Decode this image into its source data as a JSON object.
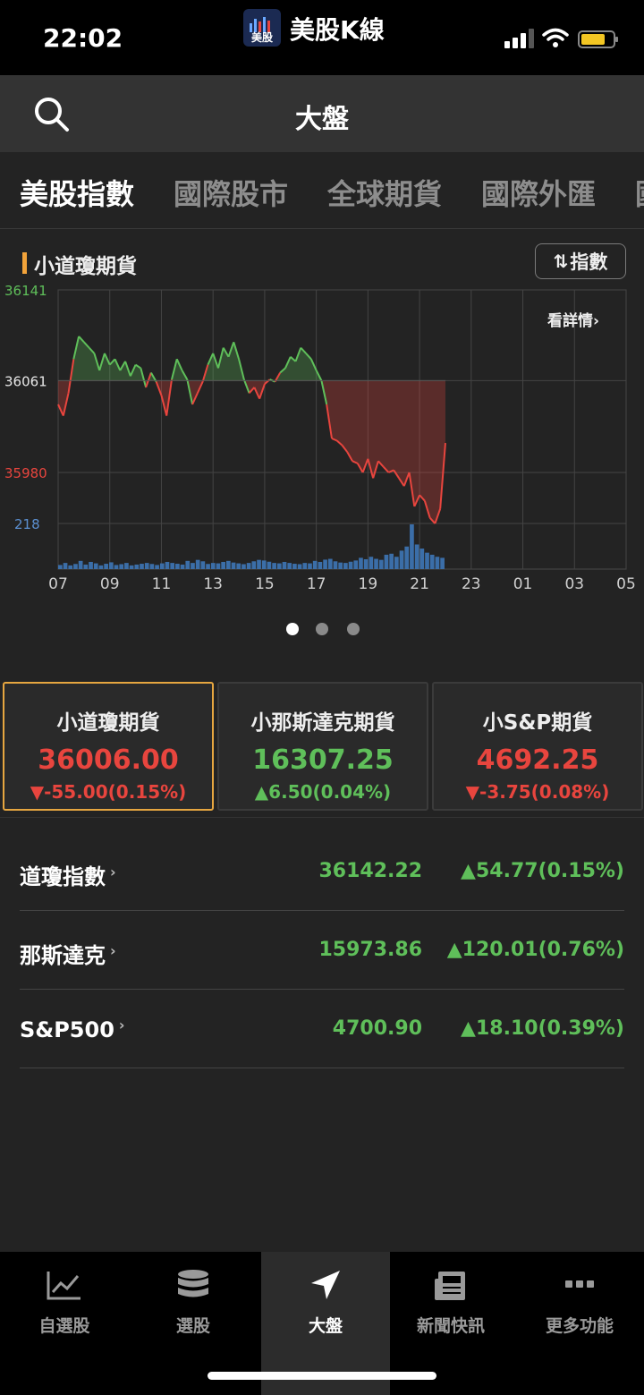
{
  "status": {
    "time": "22:02",
    "app_name": "美股K線",
    "app_badge": "美股"
  },
  "nav": {
    "title": "大盤"
  },
  "tabs": [
    {
      "label": "美股指數",
      "active": true
    },
    {
      "label": "國際股市",
      "active": false
    },
    {
      "label": "全球期貨",
      "active": false
    },
    {
      "label": "國際外匯",
      "active": false
    },
    {
      "label": "國",
      "active": false
    }
  ],
  "chart_card": {
    "title": "小道瓊期貨",
    "toggle_label": "指數",
    "detail_label": "看詳情",
    "pages": 3,
    "active_page": 0
  },
  "chart_data": {
    "type": "line",
    "title": "小道瓊期貨",
    "y_ticks": [
      {
        "label": "36141",
        "value": 36141,
        "color": "#5fbf5a"
      },
      {
        "label": "36061",
        "value": 36061,
        "color": "#e8e8e8"
      },
      {
        "label": "35980",
        "value": 35980,
        "color": "#e8453e"
      }
    ],
    "ylim": [
      35980,
      36141
    ],
    "reference": 36061,
    "x_ticks": [
      "07",
      "09",
      "11",
      "13",
      "15",
      "17",
      "19",
      "21",
      "23",
      "01",
      "03",
      "05"
    ],
    "x_range_hours": [
      7,
      29
    ],
    "volume_label": "218",
    "volume_max": 218,
    "price_points": [
      [
        7.0,
        36040
      ],
      [
        7.2,
        36030
      ],
      [
        7.4,
        36050
      ],
      [
        7.6,
        36080
      ],
      [
        7.8,
        36100
      ],
      [
        8.0,
        36095
      ],
      [
        8.2,
        36090
      ],
      [
        8.4,
        36085
      ],
      [
        8.6,
        36070
      ],
      [
        8.8,
        36085
      ],
      [
        9.0,
        36075
      ],
      [
        9.2,
        36080
      ],
      [
        9.4,
        36070
      ],
      [
        9.6,
        36078
      ],
      [
        9.8,
        36065
      ],
      [
        10.0,
        36075
      ],
      [
        10.2,
        36072
      ],
      [
        10.4,
        36055
      ],
      [
        10.6,
        36068
      ],
      [
        10.8,
        36060
      ],
      [
        11.0,
        36048
      ],
      [
        11.2,
        36030
      ],
      [
        11.4,
        36062
      ],
      [
        11.6,
        36080
      ],
      [
        11.8,
        36070
      ],
      [
        12.0,
        36062
      ],
      [
        12.2,
        36040
      ],
      [
        12.4,
        36050
      ],
      [
        12.6,
        36060
      ],
      [
        12.8,
        36075
      ],
      [
        13.0,
        36085
      ],
      [
        13.2,
        36072
      ],
      [
        13.4,
        36090
      ],
      [
        13.6,
        36082
      ],
      [
        13.8,
        36095
      ],
      [
        14.0,
        36080
      ],
      [
        14.2,
        36062
      ],
      [
        14.4,
        36050
      ],
      [
        14.6,
        36055
      ],
      [
        14.8,
        36045
      ],
      [
        15.0,
        36058
      ],
      [
        15.2,
        36062
      ],
      [
        15.4,
        36060
      ],
      [
        15.6,
        36068
      ],
      [
        15.8,
        36072
      ],
      [
        16.0,
        36082
      ],
      [
        16.2,
        36078
      ],
      [
        16.4,
        36090
      ],
      [
        16.6,
        36085
      ],
      [
        16.8,
        36080
      ],
      [
        17.0,
        36070
      ],
      [
        17.2,
        36061
      ],
      [
        17.4,
        36040
      ],
      [
        17.6,
        36010
      ],
      [
        17.8,
        36008
      ],
      [
        18.0,
        36004
      ],
      [
        18.2,
        35998
      ],
      [
        18.4,
        35990
      ],
      [
        18.6,
        35988
      ],
      [
        18.8,
        35980
      ],
      [
        19.0,
        35992
      ],
      [
        19.2,
        35975
      ],
      [
        19.4,
        35990
      ],
      [
        19.6,
        35985
      ],
      [
        19.8,
        35980
      ],
      [
        20.0,
        35982
      ],
      [
        20.2,
        35975
      ],
      [
        20.4,
        35968
      ],
      [
        20.6,
        35980
      ],
      [
        20.8,
        35950
      ],
      [
        21.0,
        35960
      ],
      [
        21.2,
        35955
      ],
      [
        21.4,
        35940
      ],
      [
        21.6,
        35935
      ],
      [
        21.8,
        35948
      ],
      [
        22.0,
        36006
      ]
    ],
    "volume": [
      20,
      30,
      18,
      25,
      40,
      22,
      35,
      28,
      18,
      26,
      33,
      20,
      24,
      30,
      18,
      22,
      26,
      30,
      25,
      20,
      28,
      35,
      30,
      26,
      22,
      40,
      30,
      45,
      38,
      25,
      30,
      28,
      35,
      40,
      32,
      28,
      24,
      30,
      38,
      45,
      42,
      36,
      30,
      28,
      35,
      30,
      26,
      24,
      30,
      28,
      40,
      35,
      46,
      50,
      38,
      32,
      30,
      36,
      42,
      55,
      48,
      60,
      50,
      45,
      70,
      75,
      60,
      90,
      110,
      218,
      120,
      100,
      80,
      70,
      60,
      55
    ]
  },
  "futures": [
    {
      "name": "小道瓊期貨",
      "price": "36006.00",
      "change": "▼-55.00(0.15%)",
      "dir": "down",
      "selected": true
    },
    {
      "name": "小那斯達克期貨",
      "price": "16307.25",
      "change": "▲6.50(0.04%)",
      "dir": "up",
      "selected": false
    },
    {
      "name": "小S&P期貨",
      "price": "4692.25",
      "change": "▼-3.75(0.08%)",
      "dir": "down",
      "selected": false
    }
  ],
  "indices": [
    {
      "name": "道瓊指數",
      "value": "36142.22",
      "change": "▲54.77(0.15%)"
    },
    {
      "name": "那斯達克",
      "value": "15973.86",
      "change": "▲120.01(0.76%)"
    },
    {
      "name": "S&P500",
      "value": "4700.90",
      "change": "▲18.10(0.39%)"
    }
  ],
  "bottom_nav": [
    {
      "label": "自選股",
      "icon": "chart-line-icon",
      "active": false
    },
    {
      "label": "選股",
      "icon": "database-icon",
      "active": false
    },
    {
      "label": "大盤",
      "icon": "navigation-arrow-icon",
      "active": true
    },
    {
      "label": "新聞快訊",
      "icon": "newspaper-icon",
      "active": false
    },
    {
      "label": "更多功能",
      "icon": "more-dots-icon",
      "active": false
    }
  ],
  "colors": {
    "up": "#5fbf5a",
    "down": "#e8453e",
    "accent": "#e6a640",
    "volume": "#3b6ea8"
  }
}
